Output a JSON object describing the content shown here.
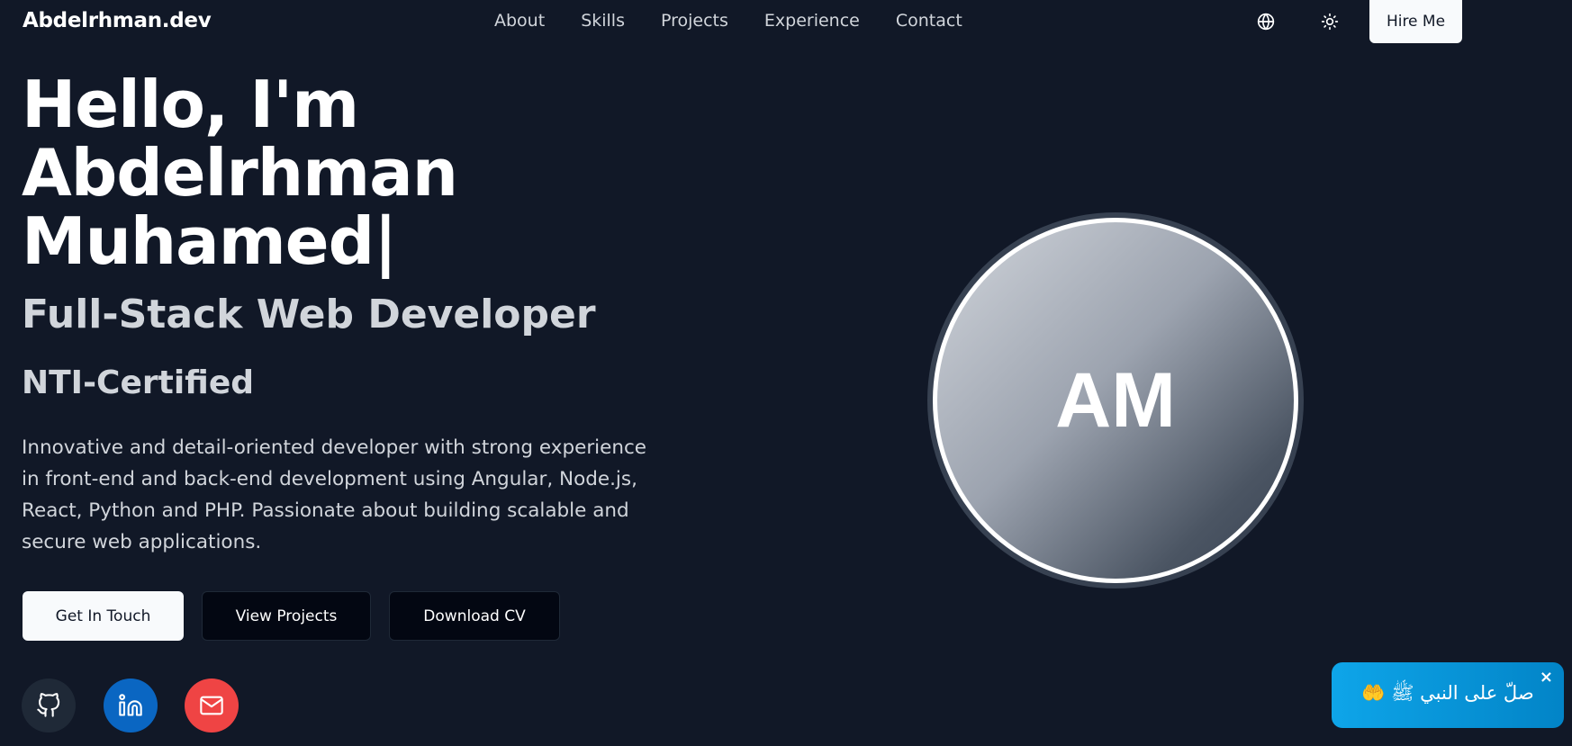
{
  "header": {
    "logo": "Abdelrhman.dev",
    "nav": [
      "About",
      "Skills",
      "Projects",
      "Experience",
      "Contact"
    ],
    "hire_label": "Hire Me",
    "icons": [
      "globe-icon",
      "sun-icon"
    ]
  },
  "hero": {
    "title_lines": [
      "Hello, I'm",
      "Abdelrhman",
      "Muhamed|"
    ],
    "subtitle": "Full-Stack Web Developer",
    "certification": "NTI-Certified",
    "description": "Innovative and detail-oriented developer with strong experience in front-end and back-end development using Angular, Node.js, React, Python and PHP. Passionate about building scalable and secure web applications.",
    "buttons": {
      "touch": "Get In Touch",
      "projects": "View Projects",
      "cv": "Download CV"
    },
    "social_icons": [
      "github-icon",
      "linkedin-icon",
      "mail-icon"
    ]
  },
  "avatar": {
    "initials": "AM"
  },
  "toast": {
    "text": "صلّ على النبي ﷺ 🤲",
    "close": "×"
  },
  "colors": {
    "background": "#111827",
    "toast": "#0ea5e9",
    "linkedin": "#0a66c2",
    "mail": "#ef4444"
  }
}
